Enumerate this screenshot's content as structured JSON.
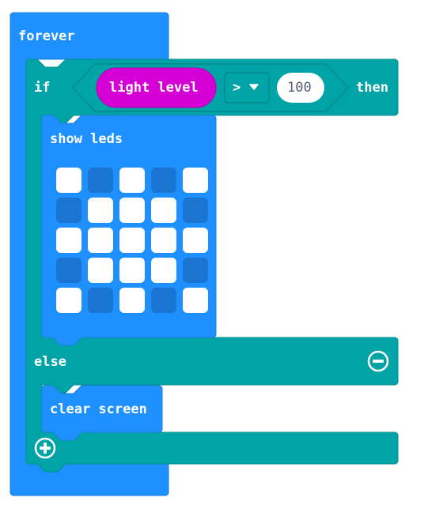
{
  "colors": {
    "forever": "#1e90ff",
    "logic": "#00a4a6",
    "sensor": "#d400d4",
    "led_on": "#ffffff",
    "led_off": "#1975d1"
  },
  "forever_block": {
    "label": "forever"
  },
  "if_block": {
    "if_label": "if",
    "then_label": "then",
    "else_label": "else",
    "condition": {
      "left": "light level",
      "operator": ">",
      "operator_icon": "dropdown-caret-icon",
      "right": "100"
    },
    "remove_else_icon": "minus-circle-icon",
    "add_branch_icon": "plus-circle-icon"
  },
  "show_leds_block": {
    "label": "show leds",
    "grid": [
      [
        1,
        0,
        1,
        0,
        1
      ],
      [
        0,
        1,
        1,
        1,
        0
      ],
      [
        1,
        1,
        1,
        1,
        1
      ],
      [
        0,
        1,
        1,
        1,
        0
      ],
      [
        1,
        0,
        1,
        0,
        1
      ]
    ]
  },
  "clear_screen_block": {
    "label": "clear screen"
  }
}
